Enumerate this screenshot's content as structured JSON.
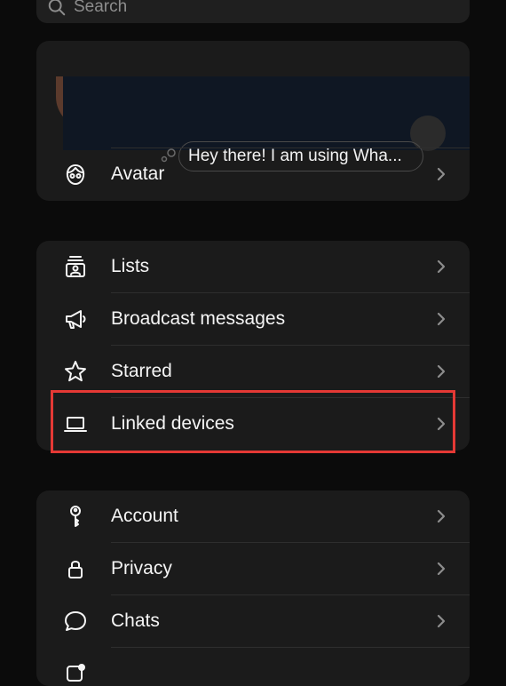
{
  "search": {
    "placeholder": "Search"
  },
  "profile": {
    "status": "Hey there! I am using Wha...",
    "avatar_label": "Avatar"
  },
  "tools_section": [
    {
      "label": "Lists",
      "icon": "lists-icon"
    },
    {
      "label": "Broadcast messages",
      "icon": "megaphone-icon"
    },
    {
      "label": "Starred",
      "icon": "star-icon"
    },
    {
      "label": "Linked devices",
      "icon": "laptop-icon"
    }
  ],
  "settings_section": [
    {
      "label": "Account",
      "icon": "key-icon"
    },
    {
      "label": "Privacy",
      "icon": "lock-icon"
    },
    {
      "label": "Chats",
      "icon": "chat-bubble-icon"
    }
  ],
  "colors": {
    "background": "#0b0b0b",
    "card": "#1b1b1b",
    "highlight": "#e53935",
    "text": "#f5f5f5",
    "chevron": "#8d8d8d"
  }
}
